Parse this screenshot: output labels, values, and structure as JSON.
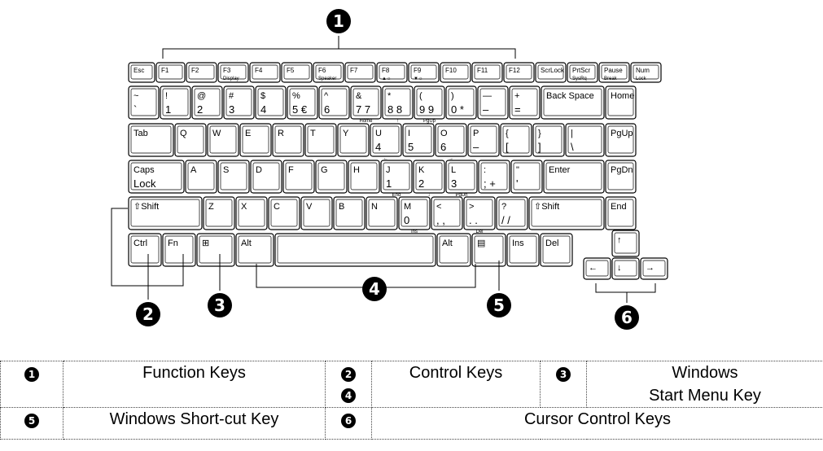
{
  "diagram": {
    "callouts": [
      "1",
      "2",
      "3",
      "4",
      "5",
      "6"
    ],
    "keyboard": {
      "rows": [
        [
          {
            "t": "Esc"
          },
          {
            "t": "F1"
          },
          {
            "t": "F2"
          },
          {
            "t": "F3",
            "b": "Display"
          },
          {
            "t": "F4"
          },
          {
            "t": "F5"
          },
          {
            "t": "F6",
            "b": "Speaker"
          },
          {
            "t": "F7"
          },
          {
            "t": "F8",
            "b": "▲☼"
          },
          {
            "t": "F9",
            "b": "▼☼"
          },
          {
            "t": "F10"
          },
          {
            "t": "F11"
          },
          {
            "t": "F12"
          },
          {
            "t": "ScrLock"
          },
          {
            "t": "PrtScr",
            "b": "SysRq"
          },
          {
            "t": "Pause",
            "b": "Break"
          },
          {
            "t": "Num",
            "b": "Lock"
          }
        ],
        [
          {
            "t": "~",
            "b": "`"
          },
          {
            "t": "!",
            "b": "1"
          },
          {
            "t": "@",
            "b": "2"
          },
          {
            "t": "#",
            "b": "3"
          },
          {
            "t": "$",
            "b": "4"
          },
          {
            "t": "%",
            "b": "5 €"
          },
          {
            "t": "^",
            "b": "6"
          },
          {
            "t": "&",
            "b": "7 7",
            "s": "Home"
          },
          {
            "t": "*",
            "b": "8 8",
            "s": "↑"
          },
          {
            "t": "(",
            "b": "9 9",
            "s": "PgUp"
          },
          {
            "t": ")",
            "b": "0 *"
          },
          {
            "t": "—",
            "b": "–"
          },
          {
            "t": "+",
            "b": "="
          },
          {
            "t": "Back Space"
          },
          {
            "t": "Home"
          }
        ],
        [
          {
            "t": "Tab"
          },
          {
            "t": "Q"
          },
          {
            "t": "W"
          },
          {
            "t": "E"
          },
          {
            "t": "R"
          },
          {
            "t": "T"
          },
          {
            "t": "Y"
          },
          {
            "t": "U",
            "b": "4",
            "s": "←"
          },
          {
            "t": "I",
            "b": "5"
          },
          {
            "t": "O",
            "b": "6",
            "s": "→"
          },
          {
            "t": "P",
            "b": "–"
          },
          {
            "t": "{",
            "b": "["
          },
          {
            "t": "}",
            "b": "]"
          },
          {
            "t": "|",
            "b": "\\"
          },
          {
            "t": "PgUp"
          }
        ],
        [
          {
            "t": "Caps",
            "b": "Lock"
          },
          {
            "t": "A"
          },
          {
            "t": "S"
          },
          {
            "t": "D"
          },
          {
            "t": "F"
          },
          {
            "t": "G"
          },
          {
            "t": "H"
          },
          {
            "t": "J",
            "b": "1",
            "s": "End"
          },
          {
            "t": "K",
            "b": "2",
            "s": "↓"
          },
          {
            "t": "L",
            "b": "3",
            "s": "PgDn"
          },
          {
            "t": ":",
            "b": "; +"
          },
          {
            "t": "\"",
            "b": "'"
          },
          {
            "t": "Enter"
          },
          {
            "t": "PgDn"
          }
        ],
        [
          {
            "t": "⇧Shift"
          },
          {
            "t": "Z"
          },
          {
            "t": "X"
          },
          {
            "t": "C"
          },
          {
            "t": "V"
          },
          {
            "t": "B"
          },
          {
            "t": "N"
          },
          {
            "t": "M",
            "b": "0",
            "s": "Ins"
          },
          {
            "t": "<",
            "b": ", ,"
          },
          {
            "t": ">",
            "b": ". .",
            "s": "Del"
          },
          {
            "t": "?",
            "b": "/ /"
          },
          {
            "t": "⇧Shift"
          },
          {
            "t": "End"
          }
        ],
        [
          {
            "t": "Ctrl"
          },
          {
            "t": "Fn"
          },
          {
            "t": "⊞"
          },
          {
            "t": "Alt"
          },
          {
            "t": ""
          },
          {
            "t": "Alt"
          },
          {
            "t": "▤"
          },
          {
            "t": "Ins"
          },
          {
            "t": "Del"
          },
          {
            "t": "↑"
          },
          {
            "t": "←"
          },
          {
            "t": "↓"
          },
          {
            "t": "→"
          }
        ]
      ]
    }
  },
  "legend": {
    "row1": {
      "n1": "1",
      "function_keys": "Function Keys",
      "n2": "2",
      "n4": "4",
      "control_keys": "Control Keys",
      "n3": "3",
      "windows_start_line1": "Windows",
      "windows_start_line2": "Start Menu Key"
    },
    "row2": {
      "n5": "5",
      "windows_shortcut": "Windows Short-cut Key",
      "n6": "6",
      "cursor_control": "Cursor Control Keys"
    }
  }
}
